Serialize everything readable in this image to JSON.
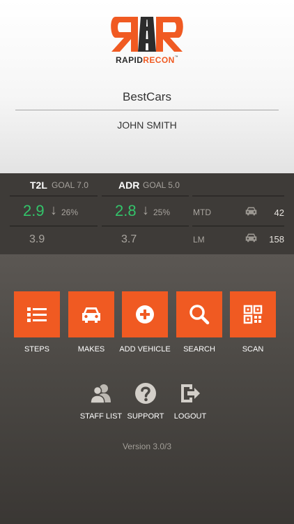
{
  "brand": {
    "logo_part1": "RAPID",
    "logo_part2": "RECON",
    "logo_tm": "™",
    "accent_color": "#f05a22"
  },
  "header": {
    "dealer_name": "BestCars",
    "user_name": "JOHN SMITH"
  },
  "stats": {
    "t2l": {
      "label": "T2L",
      "goal": "GOAL 7.0",
      "current": "2.9",
      "change": "26%",
      "trend_icon": "arrow-down-icon",
      "previous": "3.9"
    },
    "adr": {
      "label": "ADR",
      "goal": "GOAL 5.0",
      "current": "2.8",
      "change": "25%",
      "trend_icon": "arrow-down-icon",
      "previous": "3.7"
    },
    "mtd": {
      "label": "MTD",
      "count": "42",
      "icon": "car-icon"
    },
    "lm": {
      "label": "LM",
      "count": "158",
      "icon": "car-icon"
    },
    "good_color": "#33c46a"
  },
  "actions": [
    {
      "label": "STEPS",
      "icon": "list-icon"
    },
    {
      "label": "MAKES",
      "icon": "car-icon"
    },
    {
      "label": "ADD VEHICLE",
      "icon": "plus-circle-icon"
    },
    {
      "label": "SEARCH",
      "icon": "search-icon"
    },
    {
      "label": "SCAN",
      "icon": "qr-code-icon"
    }
  ],
  "secondary": [
    {
      "label": "STAFF LIST",
      "icon": "users-icon"
    },
    {
      "label": "SUPPORT",
      "icon": "help-icon"
    },
    {
      "label": "LOGOUT",
      "icon": "logout-icon"
    }
  ],
  "footer": {
    "version": "Version 3.0/3"
  }
}
